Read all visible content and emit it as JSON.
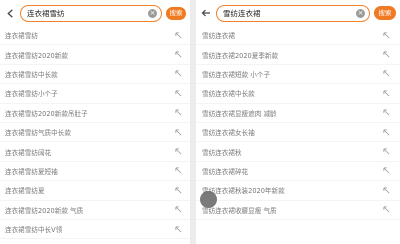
{
  "left": {
    "search": {
      "value": "连衣裙雪纺",
      "clear_icon": "×",
      "button": "搜索"
    },
    "suggestions": [
      "连衣裙雪纺",
      "连衣裙雪纺2020新款",
      "连衣裙雪纺中长款",
      "连衣裙雪纺小个子",
      "连衣裙雪纺2020新款吊肚子",
      "连衣裙雪纺气质中长款",
      "连衣裙雪纺阔花",
      "连衣裙雪纺夏短袖",
      "连衣裙雪纺夏",
      "连衣裙雪纺2020新款 气质",
      "连衣裙雪纺中长V领"
    ]
  },
  "right": {
    "search": {
      "value": "雪纺连衣裙",
      "clear_icon": "×",
      "button": "搜索"
    },
    "suggestions": [
      "雪纺连衣裙",
      "雪纺连衣裙2020夏季新款",
      "雪纺连衣裙短款 小个子",
      "雪纺连衣裙中长款",
      "雪纺连衣裙显瘦遮肉 减龄",
      "雪纺连衣裙女长袖",
      "雪纺连衣裙秋",
      "雪纺连衣裙碎花",
      "雪纺连衣裙秋装2020年新款",
      "雪纺连衣裙收腰显瘦 气质"
    ]
  },
  "colors": {
    "accent": "#f07a22",
    "border": "#f0822e",
    "text_muted": "#777777"
  }
}
